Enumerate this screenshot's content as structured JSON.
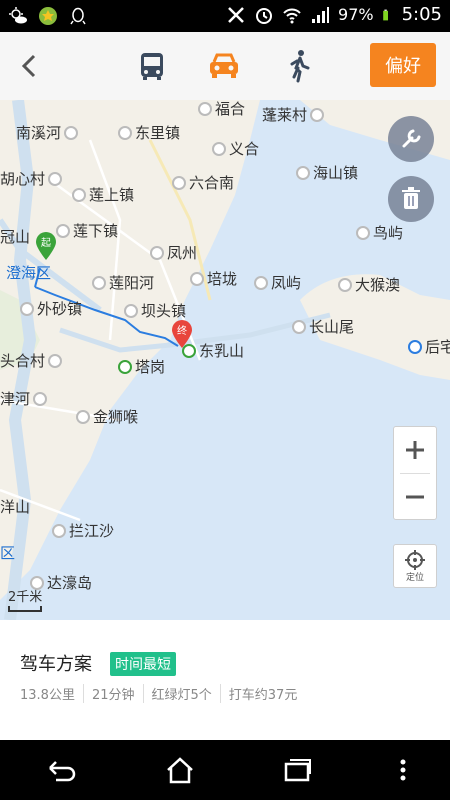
{
  "status_bar": {
    "battery": "97%",
    "time": "5:05"
  },
  "topbar": {
    "pref_label": "偏好"
  },
  "map": {
    "places": [
      "南溪河",
      "东里镇",
      "福合",
      "蓬莱村",
      "义合",
      "胡心村",
      "莲上镇",
      "六合南",
      "海山镇",
      "冠山",
      "莲下镇",
      "凤州",
      "鸟屿",
      "澄海区",
      "莲阳河",
      "培垅",
      "凤屿",
      "大猴澳",
      "外砂镇",
      "坝头镇",
      "长山尾",
      "头合村",
      "东乳山",
      "塔岗",
      "后宅",
      "津河",
      "金狮喉",
      "洋山",
      "拦江沙",
      "区",
      "达濠岛"
    ],
    "start_marker": "起",
    "end_marker": "终",
    "scale": "2千米",
    "locate_label": "定位"
  },
  "route": {
    "title": "驾车方案",
    "tag": "时间最短",
    "stats": [
      "13.8公里",
      "21分钟",
      "红绿灯5个",
      "打车约37元"
    ]
  },
  "colors": {
    "accent": "#f5841f",
    "tag": "#21c08b",
    "route_line": "#2b7de0",
    "water": "#d7e7f7"
  }
}
